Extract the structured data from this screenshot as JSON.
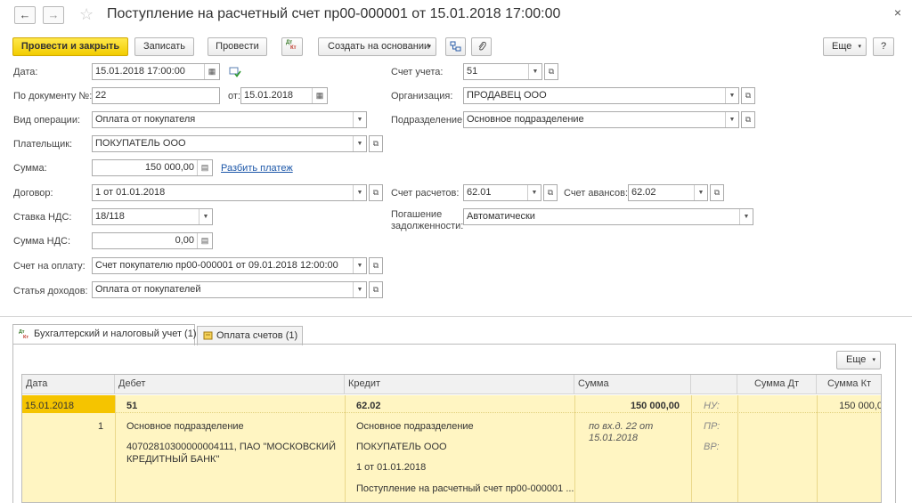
{
  "window": {
    "title": "Поступление на расчетный счет пр00-000001 от 15.01.2018 17:00:00",
    "back_glyph": "←",
    "forward_glyph": "→",
    "star_glyph": "☆",
    "close_glyph": "×"
  },
  "toolbar": {
    "post_close": "Провести и закрыть",
    "save": "Записать",
    "post": "Провести",
    "dtkt_icon": "Дт/Кт",
    "create_based": "Создать на основании",
    "more": "Еще",
    "help": "?"
  },
  "form": {
    "date_label": "Дата:",
    "date_value": "15.01.2018 17:00:00",
    "docnum_label": "По документу №:",
    "docnum_value": "22",
    "from_label": "от:",
    "from_value": "15.01.2018",
    "optype_label": "Вид операции:",
    "optype_value": "Оплата от покупателя",
    "payer_label": "Плательщик:",
    "payer_value": "ПОКУПАТЕЛЬ ООО",
    "sum_label": "Сумма:",
    "sum_value": "150 000,00",
    "split_link": "Разбить платеж",
    "contract_label": "Договор:",
    "contract_value": "1 от 01.01.2018",
    "vatrate_label": "Ставка НДС:",
    "vatrate_value": "18/118",
    "vatsum_label": "Сумма НДС:",
    "vatsum_value": "0,00",
    "invoice_label": "Счет на оплату:",
    "invoice_value": "Счет покупателю пр00-000001 от 09.01.2018 12:00:00",
    "income_label": "Статья доходов:",
    "income_value": "Оплата от покупателей",
    "account_label": "Счет учета:",
    "account_value": "51",
    "org_label": "Организация:",
    "org_value": "ПРОДАВЕЦ ООО",
    "dept_label": "Подразделение:",
    "dept_value": "Основное подразделение",
    "settle_label": "Счет расчетов:",
    "settle_value": "62.01",
    "advance_label": "Счет авансов:",
    "advance_value": "62.02",
    "repay_label_1": "Погашение",
    "repay_label_2": "задолженности:",
    "repay_value": "Автоматически"
  },
  "tabs": [
    {
      "label": "Бухгалтерский и налоговый учет (1)"
    },
    {
      "label": "Оплата счетов (1)"
    }
  ],
  "grid": {
    "more": "Еще",
    "headers": [
      "Дата",
      "Дебет",
      "Кредит",
      "Сумма",
      "",
      "Сумма Дт",
      "Сумма Кт"
    ],
    "row": {
      "date": "15.01.2018",
      "num": "1",
      "debit_acc": "51",
      "debit_sub1": "Основное подразделение",
      "debit_sub2": "40702810300000004111, ПАО \"МОСКОВСКИЙ",
      "debit_sub3": "КРЕДИТНЫЙ БАНК\"",
      "credit_acc": "62.02",
      "credit_sub1": "Основное подразделение",
      "credit_sub2": "ПОКУПАТЕЛЬ ООО",
      "credit_sub3": "1 от 01.01.2018",
      "credit_sub4": "Поступление на расчетный счет пр00-000001 ...",
      "sum": "150 000,00",
      "sum_note1": "по вх.д. 22 от",
      "sum_note2": "15.01.2018",
      "nu": "НУ:",
      "pr": "ПР:",
      "vr": "ВР:",
      "sum_kt": "150 000,0"
    }
  }
}
